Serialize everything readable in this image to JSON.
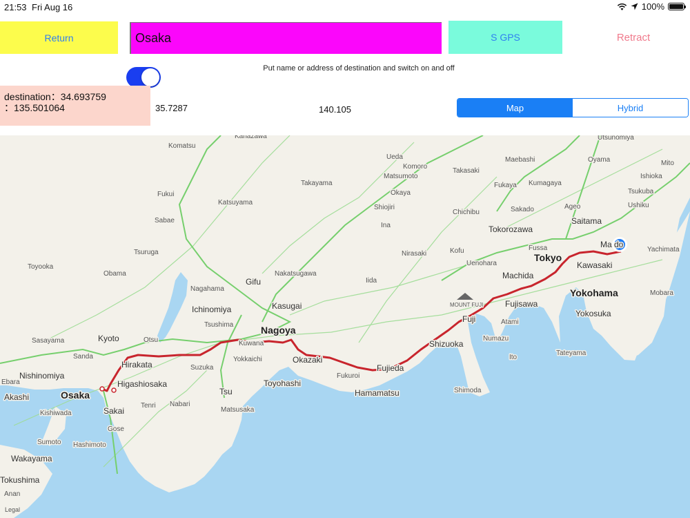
{
  "status_bar": {
    "time": "21:53",
    "date": "Fri Aug 16",
    "battery": "100%",
    "battery_level": 1.0
  },
  "toolbar": {
    "return_label": "Return",
    "destination_value": "Osaka",
    "gps_label": "S GPS",
    "retract_label": "Retract"
  },
  "instructions": "Put name or address of destination and switch on and off",
  "tracking_switch_on": true,
  "destination": {
    "line1": "destination：34.693759",
    "line2": "：135.501064"
  },
  "coords": {
    "lat": "35.7287",
    "lon": "140.105"
  },
  "map_type": {
    "options": [
      "Map",
      "Hybrid"
    ],
    "selected": "Map"
  },
  "map": {
    "labels_small": [
      "Kanazawa",
      "Komatsu",
      "Fukui",
      "Sabae",
      "Tsuruga",
      "Toyooka",
      "Obama",
      "Sasayama",
      "Sanda",
      "Kishiwada",
      "Sumoto",
      "Hashimoto",
      "Nabari",
      "Tenri",
      "Gose",
      "Matsusaka",
      "Suzuka",
      "Yokkaichi",
      "Kuwana",
      "Tsushima",
      "Nagahama",
      "Otsu",
      "Takayama",
      "Katsuyama",
      "Nakatsugawa",
      "Iida",
      "Nirasaki",
      "Kofu",
      "Uenohara",
      "Okaya",
      "Shiojiri",
      "Ina",
      "Matsumoto",
      "Ueda",
      "Komoro",
      "Takasaki",
      "Maebashi",
      "Fukaya",
      "Kumagaya",
      "Chichibu",
      "Sakado",
      "Ageo",
      "Fussa",
      "Utsunomiya",
      "Oyama",
      "Mito",
      "Ishioka",
      "Tsukuba",
      "Ushiku",
      "Yachimata",
      "Mobara",
      "Tateyama",
      "Numazu",
      "Ito",
      "Atami",
      "Shimoda",
      "Fukuroi",
      "Anan",
      "Ebara"
    ],
    "labels_medium": [
      "Hirakata",
      "Higashiosaka",
      "Nishinomiya",
      "Akashi",
      "Sakai",
      "Wakayama",
      "Tokushima",
      "Kyoto",
      "Ichinomiya",
      "Kasugai",
      "Gifu",
      "Okazaki",
      "Toyohashi",
      "Hamamatsu",
      "Fujieda",
      "Shizuoka",
      "Fuji",
      "Fujisawa",
      "Machida",
      "Kawasaki",
      "Saitama",
      "Tokorozawa",
      "Yokosuka",
      "Tsu"
    ],
    "labels_large": [
      "Osaka",
      "Nagoya",
      "Tokyo",
      "Yokohama"
    ],
    "fuji_label": "MOUNT FUJI",
    "matsudo_label": "Ma    do",
    "legal": "Legal",
    "route_color": "#c8252d",
    "land_color": "#f3f1ea",
    "water_color": "#a9d6f2",
    "road_color": "#76cf6d",
    "location_dot_color": "#1f7cf4"
  }
}
